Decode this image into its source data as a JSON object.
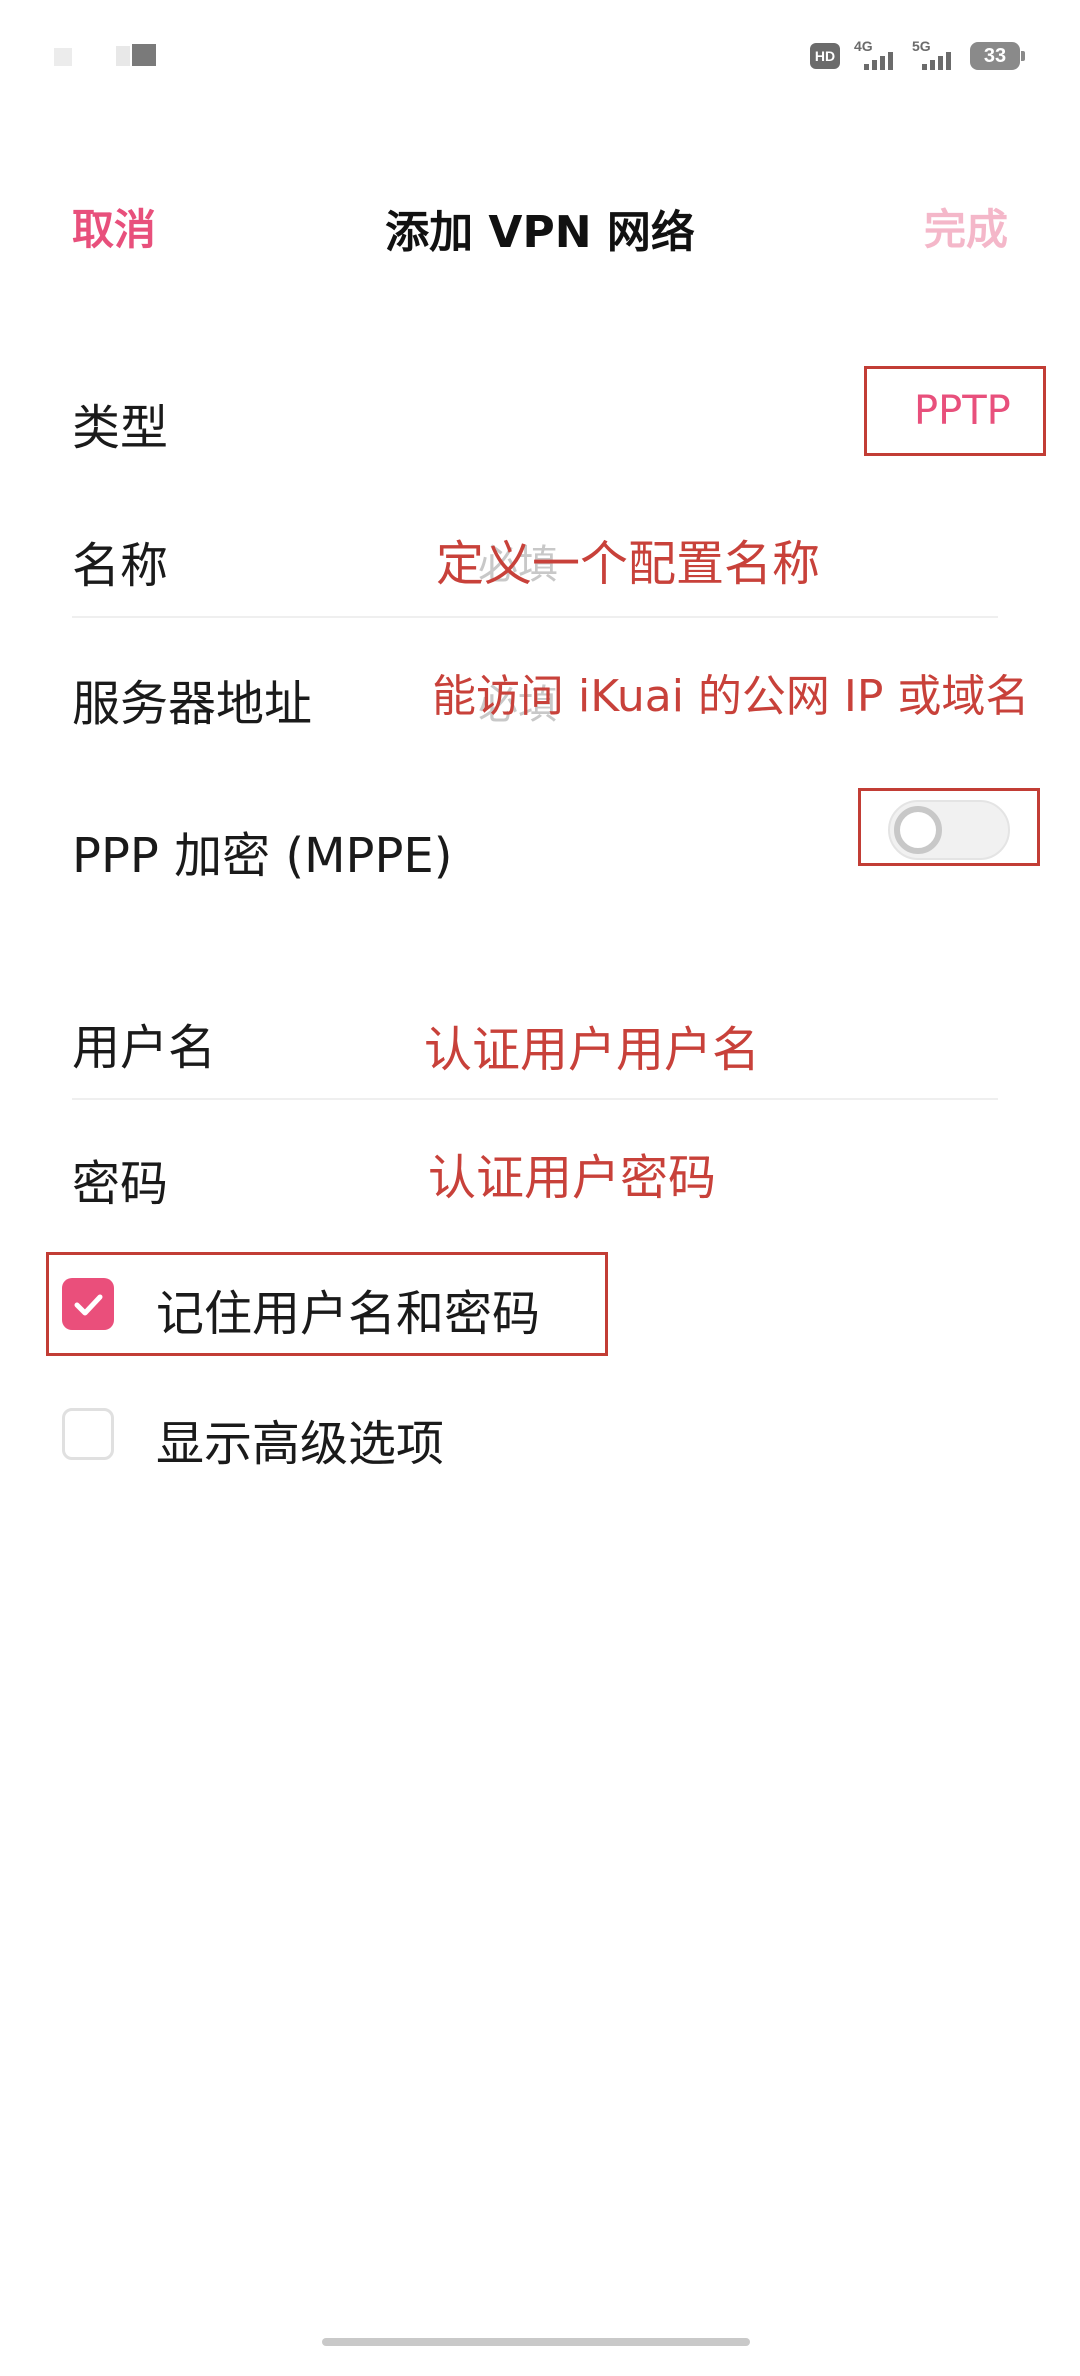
{
  "status_bar": {
    "hd_label": "HD",
    "sim1": "4G",
    "sim2": "5G",
    "battery": "33"
  },
  "header": {
    "cancel_label": "取消",
    "title": "添加 VPN 网络",
    "done_label": "完成"
  },
  "form": {
    "type_label": "类型",
    "type_value": "PPTP",
    "name_label": "名称",
    "name_placeholder": "必填",
    "server_label": "服务器地址",
    "server_placeholder": "必填",
    "ppp_label": "PPP 加密 (MPPE)",
    "ppp_enabled": false,
    "username_label": "用户名",
    "password_label": "密码",
    "remember_label": "记住用户名和密码",
    "remember_checked": true,
    "advanced_label": "显示高级选项",
    "advanced_checked": false
  },
  "annotations": {
    "name_note": "定义一个配置名称",
    "server_note": "能访问 iKuai 的公网 IP 或域名",
    "username_note": "认证用户用户名",
    "password_note": "认证用户密码"
  },
  "colors": {
    "accent": "#e8507c",
    "accent_disabled": "#f4b7c9",
    "annotation_red": "#c8413a"
  }
}
